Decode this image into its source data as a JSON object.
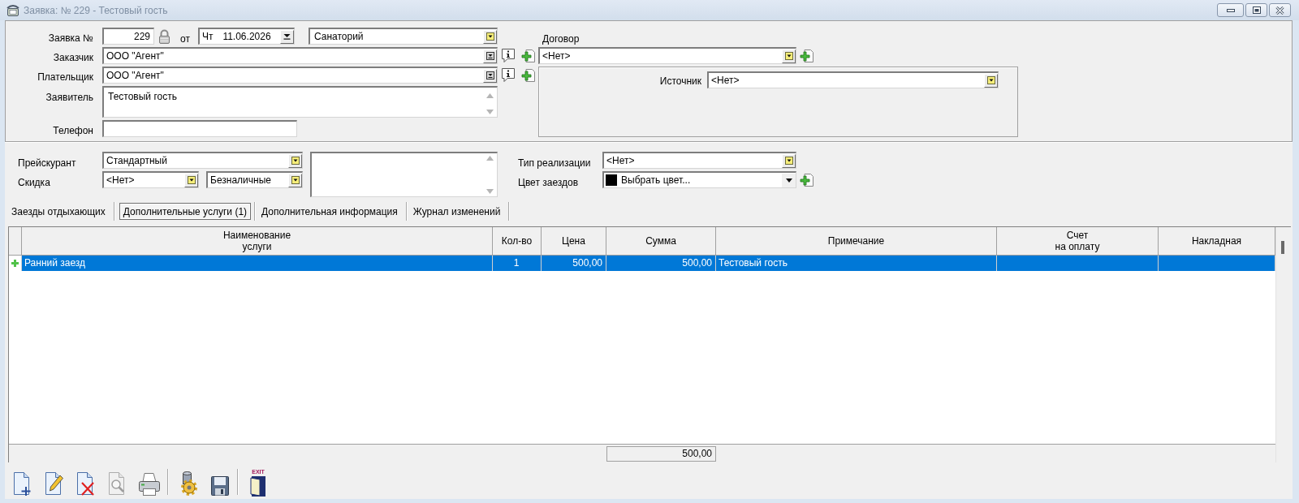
{
  "window": {
    "title": "Заявка: № 229 - Тестовый гость"
  },
  "request": {
    "number_label": "Заявка №",
    "number": "229",
    "date_label": "от",
    "weekday": "Чт",
    "date": "11.06.2026",
    "type": "Санаторий",
    "customer": {
      "label": "Заказчик",
      "value": "ООО \"Агент\""
    },
    "payer": {
      "label": "Плательщик",
      "value": "ООО \"Агент\""
    },
    "applicant": {
      "label": "Заявитель",
      "value": "Тестовый гость"
    },
    "phone": {
      "label": "Телефон"
    },
    "contract": {
      "label": "Договор",
      "value": "<Нет>"
    },
    "source": {
      "label": "Источник",
      "value": "<Нет>"
    }
  },
  "pricing": {
    "price_list": {
      "label": "Прейскурант",
      "value": "Стандартный"
    },
    "discount": {
      "label": "Скидка",
      "value": "<Нет>"
    },
    "payment_type": {
      "value": "Безналичные"
    },
    "sale_type": {
      "label": "Тип реализации",
      "value": "<Нет>"
    },
    "stay_color": {
      "label": "Цвет заездов",
      "value": "Выбрать цвет...",
      "color": "#000000"
    }
  },
  "tabs": [
    {
      "label": "Заезды отдыхающих",
      "selected": false
    },
    {
      "label": "Дополнительные услуги (1)",
      "selected": true
    },
    {
      "label": "Дополнительная информация",
      "selected": false
    },
    {
      "label": "Журнал изменений",
      "selected": false
    }
  ],
  "table": {
    "columns": [
      "Наименование\nуслуги",
      "Кол-во",
      "Цена",
      "Сумма",
      "Примечание",
      "Счет\nна оплату",
      "Накладная"
    ],
    "rows": [
      {
        "selected": true,
        "cells": [
          "Ранний заезд",
          "1",
          "500,00",
          "500,00",
          "Тестовый гость"
        ]
      }
    ],
    "total": "500,00"
  },
  "toolbar": {
    "groups": [
      {
        "buttons": [
          {
            "kind": "new",
            "disabled": false
          },
          {
            "kind": "edit",
            "disabled": false
          },
          {
            "kind": "delete",
            "disabled": false
          },
          {
            "kind": "preview",
            "disabled": true
          },
          {
            "kind": "print",
            "disabled": false
          }
        ]
      },
      {
        "buttons": [
          {
            "kind": "settings",
            "disabled": false
          },
          {
            "kind": "save",
            "disabled": false
          }
        ]
      },
      {
        "buttons": [
          {
            "kind": "exit",
            "disabled": false,
            "caption": "EXIT"
          }
        ]
      }
    ]
  }
}
